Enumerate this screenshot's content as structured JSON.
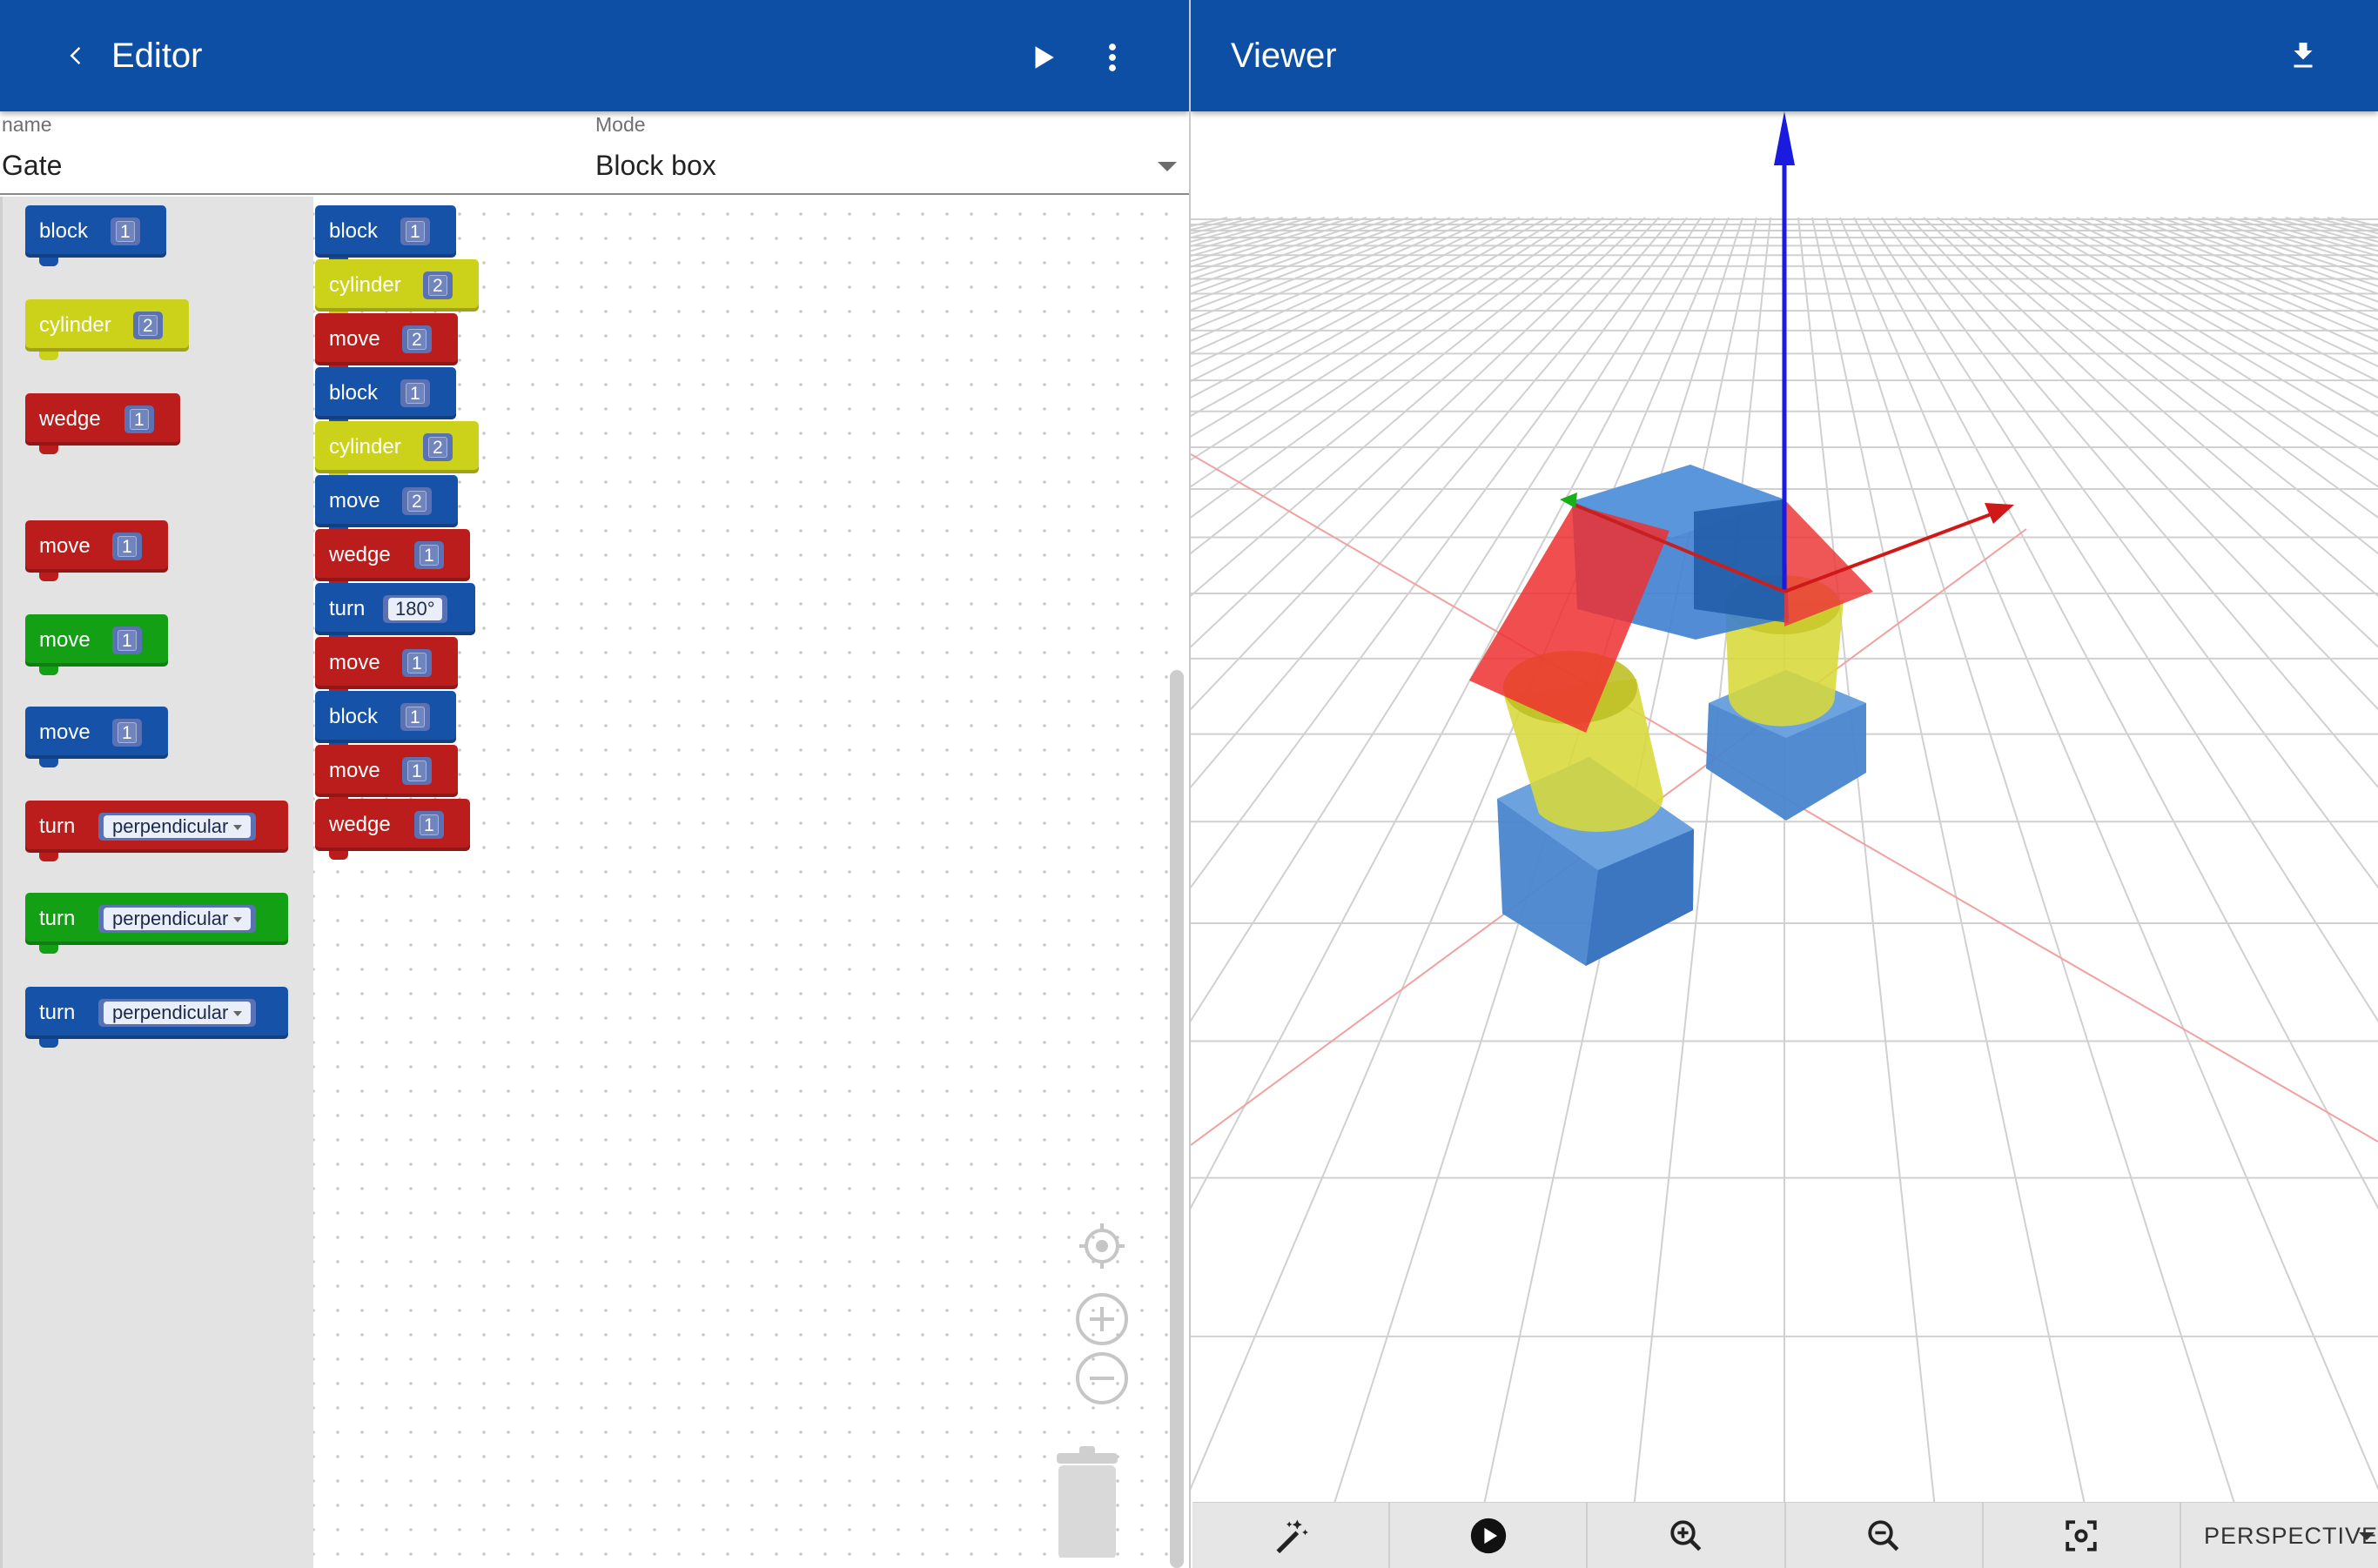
{
  "editor": {
    "title": "Editor",
    "fields": {
      "name_label": "name",
      "name_value": "Gate",
      "mode_label": "Mode",
      "mode_value": "Block box"
    },
    "toolbox": [
      {
        "label": "block",
        "value": "1",
        "color": "#1652a8"
      },
      {
        "label": "cylinder",
        "value": "2",
        "color": "#ccd11a"
      },
      {
        "label": "wedge",
        "value": "1",
        "color": "#bb1d1d"
      },
      {
        "label": "move",
        "value": "1",
        "color": "#bb1d1d"
      },
      {
        "label": "move",
        "value": "1",
        "color": "#14a014"
      },
      {
        "label": "move",
        "value": "1",
        "color": "#1652a8"
      },
      {
        "label": "turn",
        "value": "perpendicular",
        "color": "#bb1d1d"
      },
      {
        "label": "turn",
        "value": "perpendicular",
        "color": "#14a014"
      },
      {
        "label": "turn",
        "value": "perpendicular",
        "color": "#1652a8"
      }
    ],
    "program": [
      {
        "label": "block",
        "value": "1",
        "color": "#1652a8"
      },
      {
        "label": "cylinder",
        "value": "2",
        "color": "#ccd11a"
      },
      {
        "label": "move",
        "value": "2",
        "color": "#bb1d1d"
      },
      {
        "label": "block",
        "value": "1",
        "color": "#1652a8"
      },
      {
        "label": "cylinder",
        "value": "2",
        "color": "#ccd11a"
      },
      {
        "label": "move",
        "value": "2",
        "color": "#1652a8"
      },
      {
        "label": "wedge",
        "value": "1",
        "color": "#bb1d1d"
      },
      {
        "label": "turn",
        "value": "180°",
        "color": "#1652a8"
      },
      {
        "label": "move",
        "value": "1",
        "color": "#bb1d1d"
      },
      {
        "label": "block",
        "value": "1",
        "color": "#1652a8"
      },
      {
        "label": "move",
        "value": "1",
        "color": "#bb1d1d"
      },
      {
        "label": "wedge",
        "value": "1",
        "color": "#bb1d1d"
      }
    ]
  },
  "viewer": {
    "title": "Viewer",
    "camera_mode": "PERSPECTIVE"
  },
  "icons": {
    "back": "chevron-left-icon",
    "run": "play-icon",
    "more": "more-vert-icon",
    "download": "download-icon",
    "recenter": "target-icon",
    "zoom_in": "plus-circle-icon",
    "zoom_out": "minus-circle-icon",
    "trash": "trash-can-icon",
    "magic": "magic-wand-icon",
    "animate": "play-circle-icon",
    "viewer_zoom_in": "zoom-in-icon",
    "viewer_zoom_out": "zoom-out-icon",
    "fit": "fit-screen-icon"
  },
  "colors": {
    "appbar": "#0d4fa4",
    "block_blue": "#1652a8",
    "block_yellow": "#ccd11a",
    "block_red": "#bb1d1d",
    "block_green": "#14a014"
  }
}
